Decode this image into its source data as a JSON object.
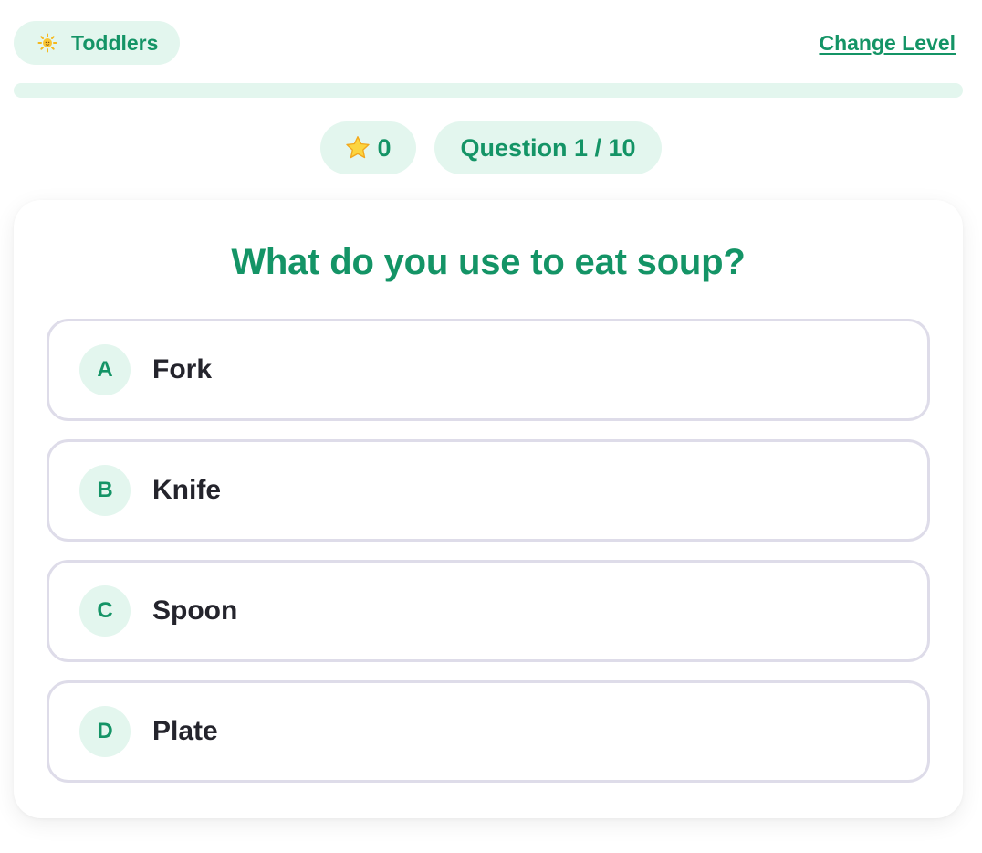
{
  "header": {
    "level_icon": "sun-icon",
    "level_label": "Toddlers",
    "change_level_label": "Change Level"
  },
  "progress": {
    "fraction": 0
  },
  "stats": {
    "star_icon": "star-icon",
    "score": "0",
    "question_counter": "Question 1 / 10"
  },
  "quiz": {
    "question": "What do you use to eat soup?",
    "options": [
      {
        "letter": "A",
        "text": "Fork"
      },
      {
        "letter": "B",
        "text": "Knife"
      },
      {
        "letter": "C",
        "text": "Spoon"
      },
      {
        "letter": "D",
        "text": "Plate"
      }
    ]
  },
  "colors": {
    "accent": "#149466",
    "pill_background": "#e3f6ee",
    "option_border": "#dedce9",
    "option_text": "#24242c"
  }
}
